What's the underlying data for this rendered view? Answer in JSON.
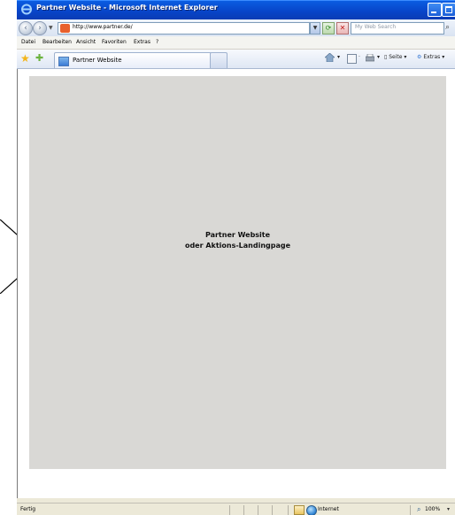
{
  "window": {
    "title": "Partner Website - Microsoft Internet Explorer"
  },
  "address_bar": {
    "url": "http://www.partner.de/",
    "search_placeholder": "My Web Search"
  },
  "menu": {
    "items": [
      "Datei",
      "Bearbeiten",
      "Ansicht",
      "Favoriten",
      "Extras",
      "?"
    ]
  },
  "favorites_bar": {
    "tab_label": "Partner Website",
    "page_label": "Seite",
    "extras_label": "Extras"
  },
  "content": {
    "headline_line1": "Partner Website",
    "headline_line2": "oder Aktions-Landingpage",
    "background_color": "#d9d8d5"
  },
  "status_bar": {
    "status": "Fertig",
    "zone": "Internet",
    "zoom": "100%"
  }
}
